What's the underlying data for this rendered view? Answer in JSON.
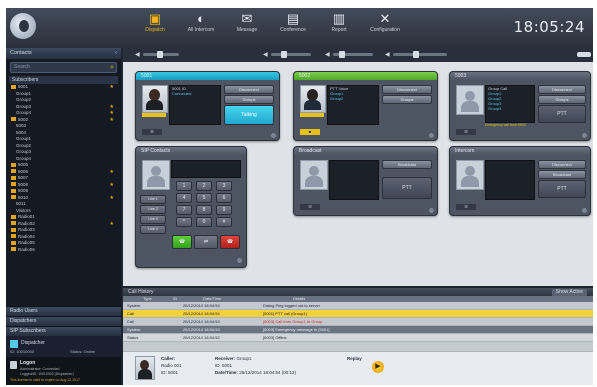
{
  "app": {
    "nav": [
      {
        "name": "dispatch",
        "label": "Dispatch",
        "icon": "dispatch-icon",
        "active": true
      },
      {
        "name": "intercom",
        "label": "All Intercom",
        "icon": "intercom-icon"
      },
      {
        "name": "message",
        "label": "Message",
        "icon": "message-icon"
      },
      {
        "name": "conference",
        "label": "Conference",
        "icon": "conference-icon"
      },
      {
        "name": "report",
        "label": "Report",
        "icon": "report-icon"
      },
      {
        "name": "config",
        "label": "Configuration",
        "icon": "tools-icon"
      }
    ],
    "clock": "18:05:24"
  },
  "sidebar": {
    "header": "Contacts",
    "search_placeholder": "Search",
    "tree_head": "Subscribers",
    "rows": [
      {
        "label": "5001",
        "folder": true,
        "star": true
      },
      {
        "label": "Group1",
        "folder": false
      },
      {
        "label": "Group2",
        "folder": false
      },
      {
        "label": "Group3",
        "folder": false,
        "star": true
      },
      {
        "label": "Group4",
        "folder": false,
        "star": true
      },
      {
        "label": "5002",
        "folder": true,
        "star": true
      },
      {
        "label": "5003",
        "folder": false
      },
      {
        "label": "5004",
        "folder": false
      },
      {
        "label": "Group1",
        "folder": false
      },
      {
        "label": "Group2",
        "folder": false
      },
      {
        "label": "Group3",
        "folder": false
      },
      {
        "label": "Group4",
        "folder": false
      },
      {
        "label": "5005",
        "folder": true
      },
      {
        "label": "5006",
        "folder": true,
        "star": true
      },
      {
        "label": "5007",
        "folder": true
      },
      {
        "label": "5008",
        "folder": true,
        "star": true
      },
      {
        "label": "5009",
        "folder": true
      },
      {
        "label": "5010",
        "folder": true,
        "star": true
      },
      {
        "label": "5011",
        "folder": false
      },
      {
        "label": "Visitors",
        "folder": false
      },
      {
        "label": "Radio01",
        "folder": true
      },
      {
        "label": "Radio02",
        "folder": true,
        "star": true
      },
      {
        "label": "Radio03",
        "folder": true
      },
      {
        "label": "Radio04",
        "folder": true
      },
      {
        "label": "Radio05",
        "folder": true
      },
      {
        "label": "Radio06",
        "folder": true
      }
    ],
    "sections": [
      "Radio Users",
      "Dispatchers",
      "SIP Subscribers"
    ],
    "dispatcher": {
      "title": "Dispatcher",
      "id": "ID: 10010003",
      "status": "Status: Online"
    },
    "login": {
      "title": "Logon",
      "line1": "Administrator: Connected",
      "line2": "Logged/ID: 10010003 (Dispatcher)",
      "note": "This license is valid to expire on Aug 12 2017"
    }
  },
  "cards": [
    {
      "title": "5001",
      "color": "cyan",
      "info": [
        "5001 ID",
        "Connected"
      ],
      "buttons": [
        "Disconnect",
        "Groups"
      ],
      "action": "Talking"
    },
    {
      "title": "5002",
      "color": "green",
      "info": [
        "PTT Voice",
        "Group1",
        "Group2"
      ],
      "buttons": [
        "Disconnect",
        "Groups"
      ]
    },
    {
      "title": "5003",
      "color": "gray",
      "info": [
        "Group Call",
        "Group1",
        "Group2",
        "Group3",
        "Group4"
      ],
      "buttons": [
        "Disconnect",
        "Groups"
      ],
      "action": "PTT",
      "note": "Emergency call from 5003"
    },
    {
      "title": "SIP Contacts",
      "color": "gray"
    },
    {
      "title": "Broadcast",
      "color": "gray",
      "buttons": [
        "Broadcast"
      ],
      "action": "PTT"
    },
    {
      "title": "Intercom",
      "color": "gray",
      "buttons": [
        "Disconnect",
        "Broadcast"
      ],
      "action": "PTT"
    }
  ],
  "keypad": [
    "1",
    "2",
    "3",
    "4",
    "5",
    "6",
    "7",
    "8",
    "9",
    "*",
    "0",
    "#"
  ],
  "keypad_side": [
    "Line 1",
    "Line 2",
    "Line 3",
    "Line 4"
  ],
  "log": {
    "title": "Call History",
    "filter": "Show Active",
    "columns": [
      "Type",
      "ID",
      "Date/Time",
      "Details"
    ],
    "rows": [
      {
        "type": "System",
        "id": "",
        "time": "25/12/2014 18:04:54",
        "details": "Dialog Ping logged out to server"
      },
      {
        "type": "Call",
        "id": "",
        "time": "25/12/2014 18:04:54",
        "details": "[5001] PTT call (Group1)",
        "style": "yellow"
      },
      {
        "type": "Call",
        "id": "",
        "time": "25/12/2014 18:04:53",
        "details": "[5003] Call from Group1 to Group",
        "red": true
      },
      {
        "type": "System",
        "id": "",
        "time": "25/12/2014 18:04:53",
        "details": "[5003] Emergency message to [5001]",
        "style": "dark"
      },
      {
        "type": "Status",
        "id": "",
        "time": "25/12/2014 18:04:52",
        "details": "[5003] Offline",
        "style": "lt"
      }
    ]
  },
  "detail": {
    "caller_label": "Caller:",
    "caller_val": "Dispatcher",
    "caller2": "Radio 001",
    "caller_id": "ID: 5001",
    "receiver_label": "Receiver:",
    "receiver_val": "Group1",
    "receiver_id": "ID: 5001",
    "date_label": "Date/Time:",
    "date_val": "25/12/2014 18:04:54 (00:12)",
    "replay": "Replay"
  }
}
